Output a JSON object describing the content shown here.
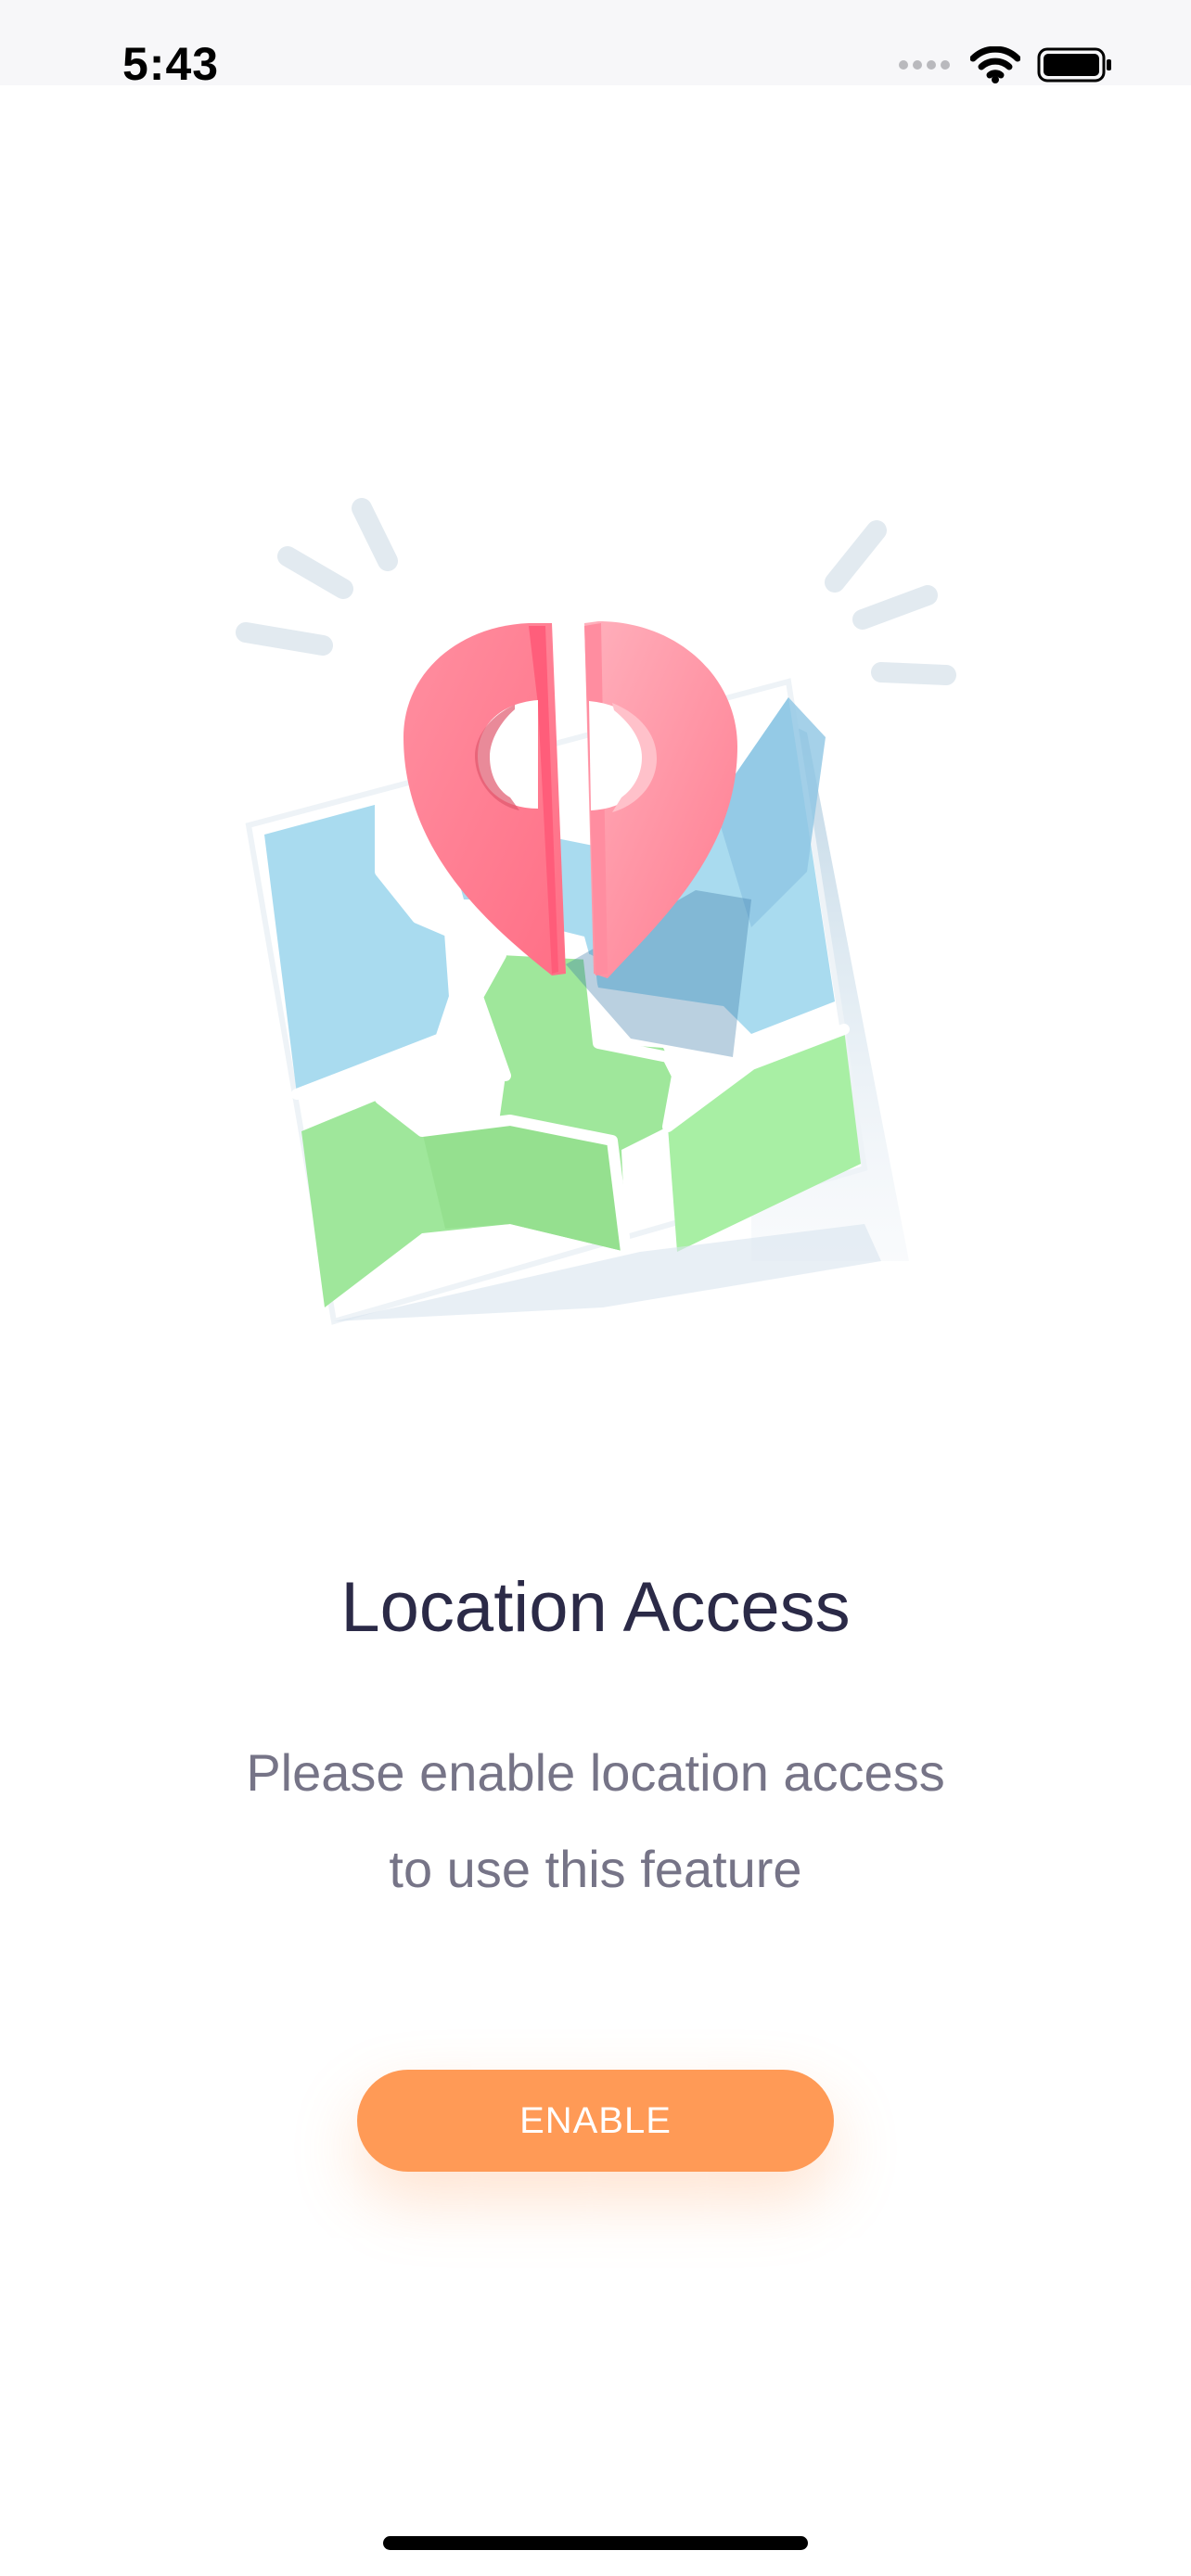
{
  "status_bar": {
    "time": "5:43",
    "icons": [
      "cellular-dots-icon",
      "wifi-icon",
      "battery-icon"
    ]
  },
  "illustration": {
    "name": "map-with-location-pin",
    "colors": {
      "water": "#a9dbef",
      "land": "#9fe79b",
      "pin": "#ff7e93",
      "sparks": "#e2eaf0"
    }
  },
  "content": {
    "title": "Location Access",
    "subtitle_line1": "Please enable location access",
    "subtitle_line2": "to use this feature"
  },
  "actions": {
    "enable_label": "ENABLE"
  },
  "colors": {
    "accent": "#ff9a56",
    "title_text": "#2b2a47",
    "body_text": "#767487"
  }
}
